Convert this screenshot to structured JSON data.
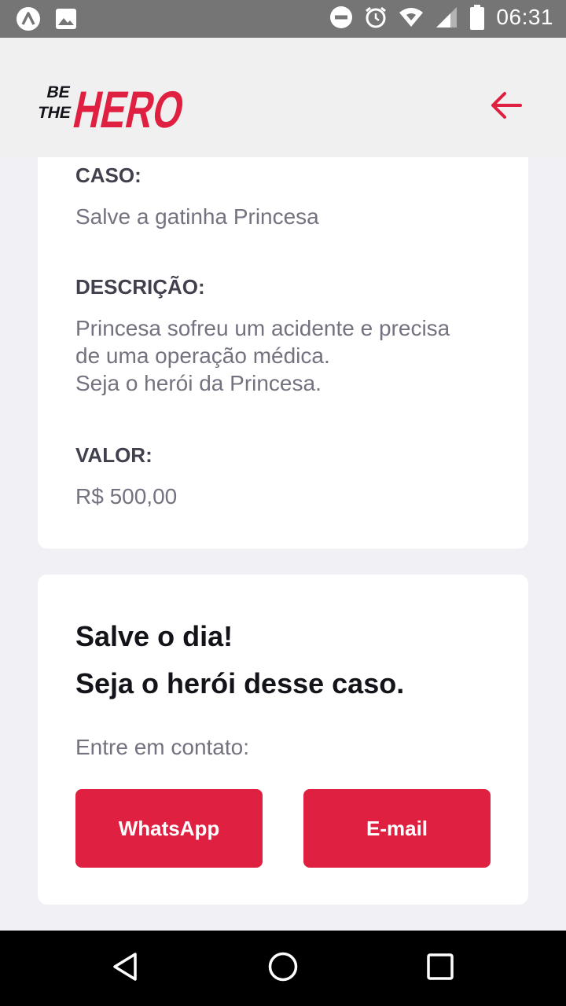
{
  "status_bar": {
    "time": "06:31",
    "icons": [
      "app-a-icon",
      "image-icon",
      "do-not-disturb-icon",
      "alarm-icon",
      "wifi-icon",
      "signal-icon",
      "battery-icon"
    ]
  },
  "header": {
    "logo_line1": "BE",
    "logo_line2": "THE",
    "logo_word": "HERO",
    "back_icon": "arrow-left-icon"
  },
  "incident": {
    "case_label": "CASO:",
    "case_value": "Salve a gatinha Princesa",
    "description_label": "DESCRIÇÃO:",
    "description_value": "Princesa sofreu um acidente e precisa\nde uma operação médica.\nSeja o herói da Princesa.",
    "value_label": "VALOR:",
    "value_value": "R$ 500,00"
  },
  "contact": {
    "title_line1": "Salve o dia!",
    "title_line2": "Seja o herói desse caso.",
    "description": "Entre em contato:",
    "whatsapp_label": "WhatsApp",
    "email_label": "E-mail"
  },
  "colors": {
    "accent": "#e02041",
    "background": "#f0f0f5",
    "label": "#41414d",
    "muted": "#737380",
    "title": "#13131a"
  }
}
